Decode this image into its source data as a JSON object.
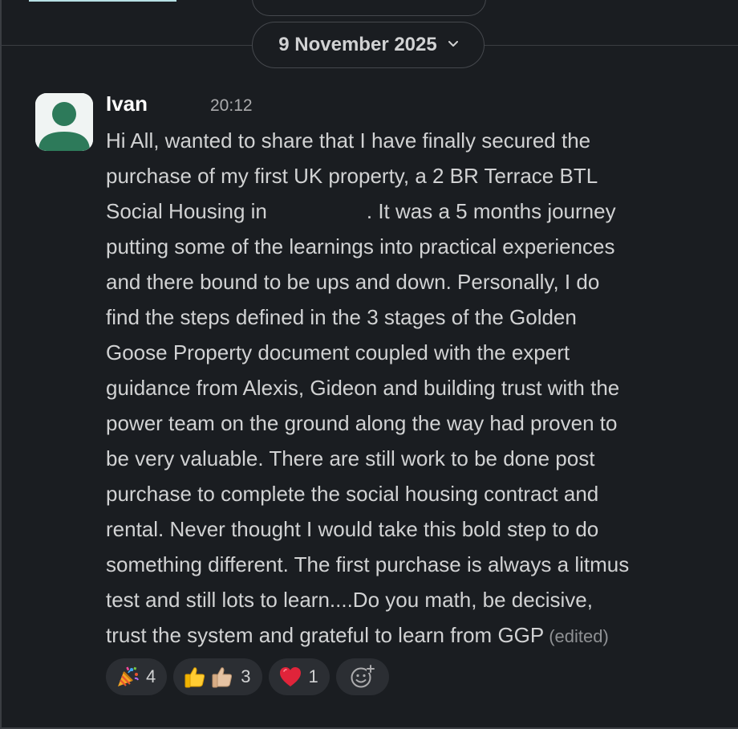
{
  "date_divider": {
    "label": "9 November 2025"
  },
  "message": {
    "author": "Ivan",
    "time": "20:12",
    "lines": [
      "Hi All, wanted to share that I have finally secured the",
      "purchase of my first UK property, a 2 BR Terrace BTL",
      "Social Housing in",
      ". It was a 5 months journey",
      "putting some of the learnings into practical experiences",
      "and there bound to be ups and down. Personally, I do",
      "find the steps defined in the 3 stages of the Golden",
      "Goose Property document coupled with the expert",
      "guidance from Alexis, Gideon and building trust with the",
      "power team on the ground along the way had proven to",
      "be very valuable. There are still work to be done post",
      "purchase to complete the social housing contract and",
      "rental. Never thought I would take this bold step to do",
      "something different. The first purchase is always a litmus",
      "test and still lots to learn....Do you math, be decisive,",
      "trust the system and grateful to learn from GGP"
    ],
    "edited_label": "(edited)"
  },
  "reactions": [
    {
      "icons": [
        "party-popper-icon"
      ],
      "count": "4"
    },
    {
      "icons": [
        "thumbs-up-icon",
        "thumbs-up-light-skin-icon"
      ],
      "count": "3"
    },
    {
      "icons": [
        "red-heart-icon"
      ],
      "count": "1"
    }
  ],
  "add_reaction": {
    "icon": "add-reaction-icon"
  },
  "colors": {
    "background": "#1a1d21",
    "text": "#d1d2d3",
    "author": "#ffffff",
    "muted": "#ababad",
    "pill_border": "#45484d",
    "reaction_bg": "#2b2e33",
    "avatar_bg": "#f0f4f3",
    "avatar_fg": "#2d7a5a",
    "accent": "#b7e0e4"
  }
}
